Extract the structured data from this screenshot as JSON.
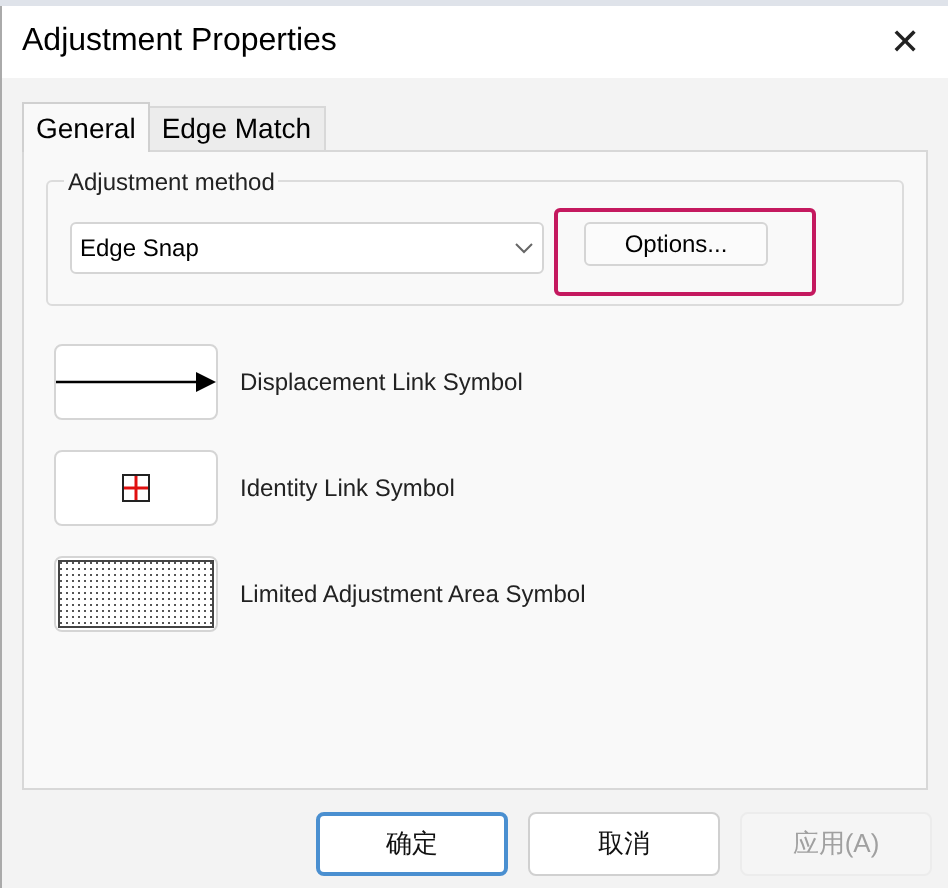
{
  "window": {
    "title": "Adjustment Properties",
    "close": "✕"
  },
  "tabs": [
    {
      "label": "General",
      "selected": true
    },
    {
      "label": "Edge Match",
      "selected": false
    }
  ],
  "group": {
    "title": "Adjustment method",
    "method": "Edge Snap",
    "options_button": "Options...",
    "highlighted": true
  },
  "symbols": [
    {
      "kind": "arrow",
      "label": "Displacement Link Symbol"
    },
    {
      "kind": "cross",
      "label": "Identity Link Symbol"
    },
    {
      "kind": "dots",
      "label": "Limited Adjustment Area Symbol"
    }
  ],
  "buttons": [
    {
      "label": "确定",
      "default": true,
      "disabled": false
    },
    {
      "label": "取消",
      "default": false,
      "disabled": false
    },
    {
      "label": "应用(A)",
      "default": false,
      "disabled": true
    }
  ]
}
